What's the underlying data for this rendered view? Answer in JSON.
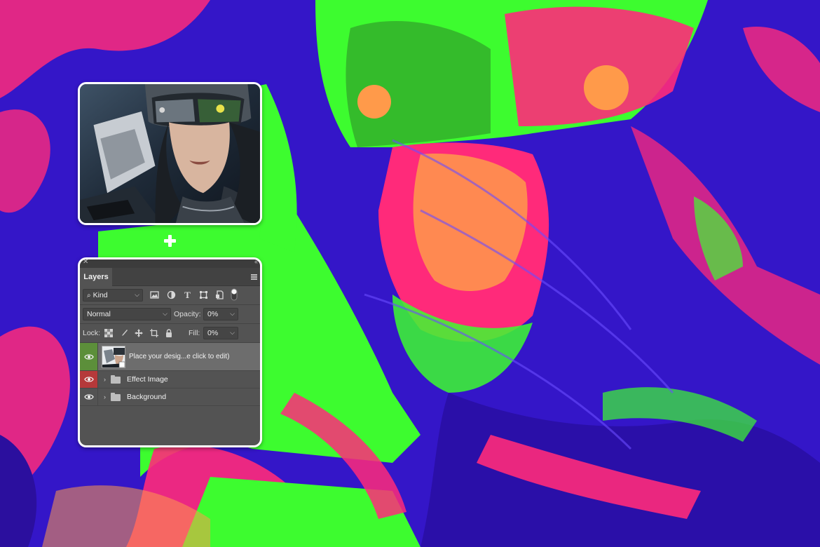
{
  "colors": {
    "bg_blue": "#3a18d8",
    "neon_green": "#3dfc2f",
    "hot_pink": "#ff1e6e",
    "orange": "#ff9a4a",
    "panel_bg": "#535353",
    "selected_row": "#6d6d6d",
    "eye_green": "#5c8f3a",
    "eye_red": "#b5393a"
  },
  "layers_panel": {
    "tab_label": "Layers",
    "filter": {
      "kind_label": "Kind",
      "icons": [
        "image-filter-icon",
        "adjustment-filter-icon",
        "type-filter-icon",
        "shape-filter-icon",
        "smart-object-filter-icon",
        "filter-toggle-icon"
      ]
    },
    "blend_mode": "Normal",
    "opacity_label": "Opacity:",
    "opacity_value": "0%",
    "lock_label": "Lock:",
    "fill_label": "Fill:",
    "fill_value": "0%",
    "layers": [
      {
        "name": "Place your desig...e click to edit)",
        "type": "smart-object",
        "selected": true,
        "eye_color": "green"
      },
      {
        "name": "Effect Image",
        "type": "group",
        "selected": false,
        "eye_color": "red"
      },
      {
        "name": "Background",
        "type": "group",
        "selected": false,
        "eye_color": "none"
      }
    ]
  }
}
